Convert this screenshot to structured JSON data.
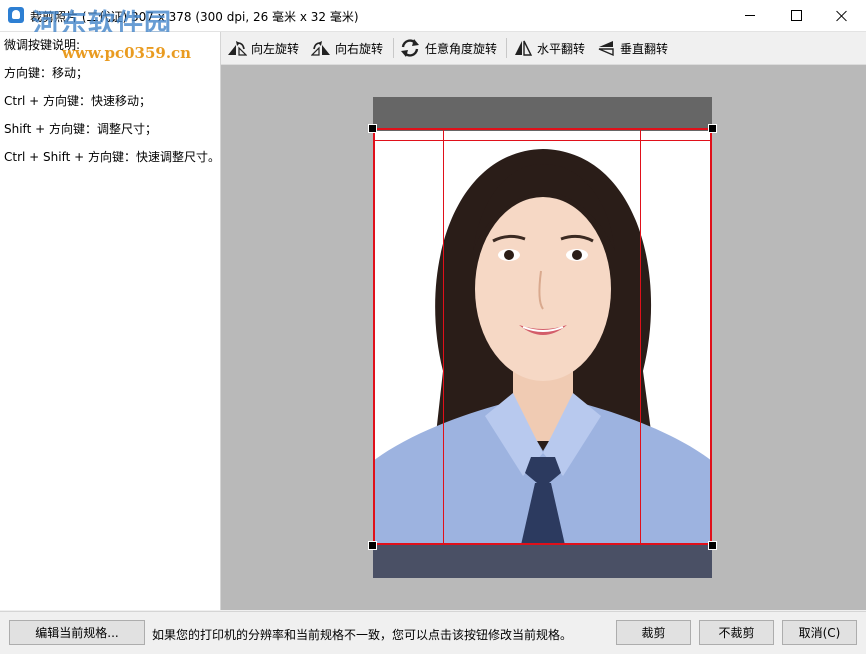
{
  "window": {
    "title": "裁剪照片 (二代证) 307 x 378 (300 dpi, 26 毫米 x 32 毫米)",
    "watermark_name": "河东软件园",
    "watermark_url": "www.pc0359.cn"
  },
  "help": {
    "lines": [
      "微调按键说明:",
      "方向键：移动；",
      "Ctrl + 方向键：快速移动；",
      "Shift + 方向键：调整尺寸；",
      "Ctrl + Shift + 方向键：快速调整尺寸。"
    ]
  },
  "toolbar": {
    "rotate_left": "向左旋转",
    "rotate_right": "向右旋转",
    "rotate_any": "任意角度旋转",
    "flip_horizontal": "水平翻转",
    "flip_vertical": "垂直翻转"
  },
  "bottom": {
    "edit_spec": "编辑当前规格...",
    "hint": "如果您的打印机的分辨率和当前规格不一致，您可以点击该按钮修改当前规格。",
    "crop": "裁剪",
    "no_crop": "不裁剪",
    "cancel": "取消(C)"
  },
  "colors": {
    "crop_line": "#e0101a",
    "canvas_bg": "#b9b9b9",
    "photo_background": "#ffffff",
    "shirt": "#9db3e0",
    "tie": "#2c3a5f",
    "hair": "#2a1d18"
  }
}
